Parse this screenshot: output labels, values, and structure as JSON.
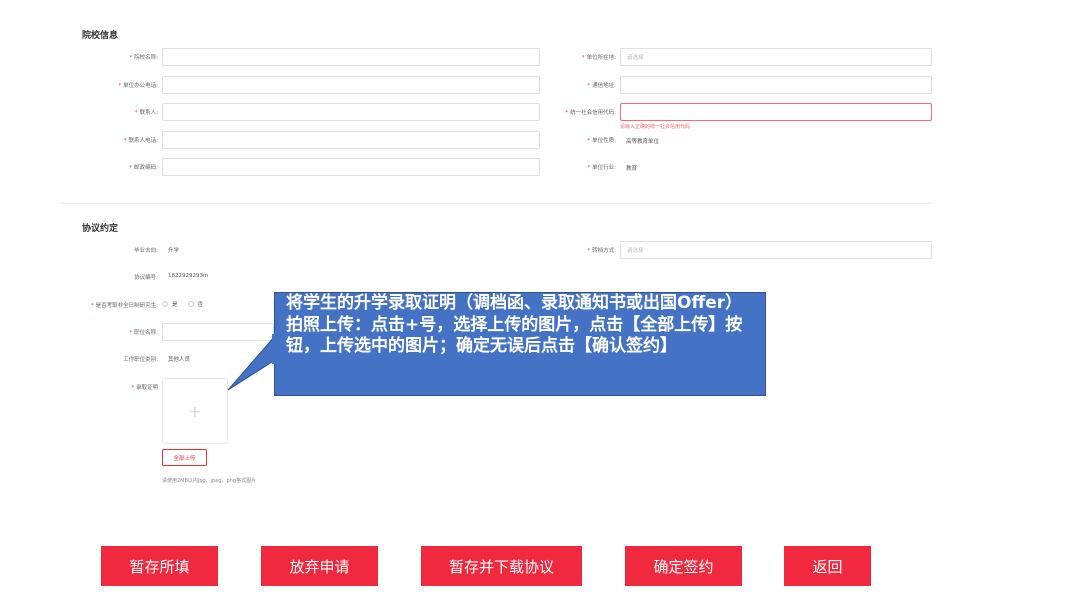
{
  "school_info": {
    "section_title": "院校信息",
    "left_fields": [
      {
        "label": "院校名称:",
        "required": true,
        "value": "",
        "placeholder": ""
      },
      {
        "label": "单位办公电话:",
        "required": true,
        "value": "",
        "placeholder": ""
      },
      {
        "label": "联系人:",
        "required": true,
        "value": "",
        "placeholder": ""
      },
      {
        "label": "联系人电话:",
        "required": true,
        "value": "",
        "placeholder": ""
      },
      {
        "label": "邮政编码:",
        "required": true,
        "value": "",
        "placeholder": ""
      }
    ],
    "right_fields": [
      {
        "label": "单位所在地:",
        "required": true,
        "placeholder": "请选择"
      },
      {
        "label": "通信地址:",
        "required": true,
        "placeholder": ""
      },
      {
        "label": "统一社会信用代码:",
        "required": true,
        "placeholder": "",
        "error": "请输入正确的统一社会信用代码"
      },
      {
        "label": "单位性质:",
        "required": true,
        "value": "高等教育单位"
      },
      {
        "label": "单位行业:",
        "required": true,
        "value": "教育"
      }
    ]
  },
  "agreement": {
    "section_title": "协议约定",
    "graduation_destination_label": "毕业去向:",
    "graduation_destination_value": "升学",
    "agreement_no_label": "协议编号:",
    "agreement_no_value": "1822929293m",
    "transfer_method_label": "转档方式:",
    "transfer_method_placeholder": "请选择",
    "fulltime_grad_label": "是否考取非全日制研究生:",
    "radio_yes": "是",
    "radio_no": "否",
    "position_name_label": "职位名称:",
    "position_category_label": "工作职位类别:",
    "position_category_value": "其他人员",
    "admission_proof_label": "录取证明",
    "upload_plus": "+",
    "upload_all_label": "全部上传",
    "upload_hint": "请使用2MB以内jpg、jpeg、png格式图片"
  },
  "callout": {
    "text": "将学生的升学录取证明（调档函、录取通知书或出国Offer）拍照上传：点击+号，选择上传的图片，点击【全部上传】按钮，上传选中的图片；确定无误后点击【确认签约】"
  },
  "actions": {
    "save_draft": "暂存所填",
    "abandon": "放弃申请",
    "save_download": "暂存并下载协议",
    "confirm_sign": "确定签约",
    "back": "返回"
  },
  "colors": {
    "primary_red": "#f0293e",
    "callout_blue": "#4472c4",
    "error_red": "#f56c6c"
  }
}
